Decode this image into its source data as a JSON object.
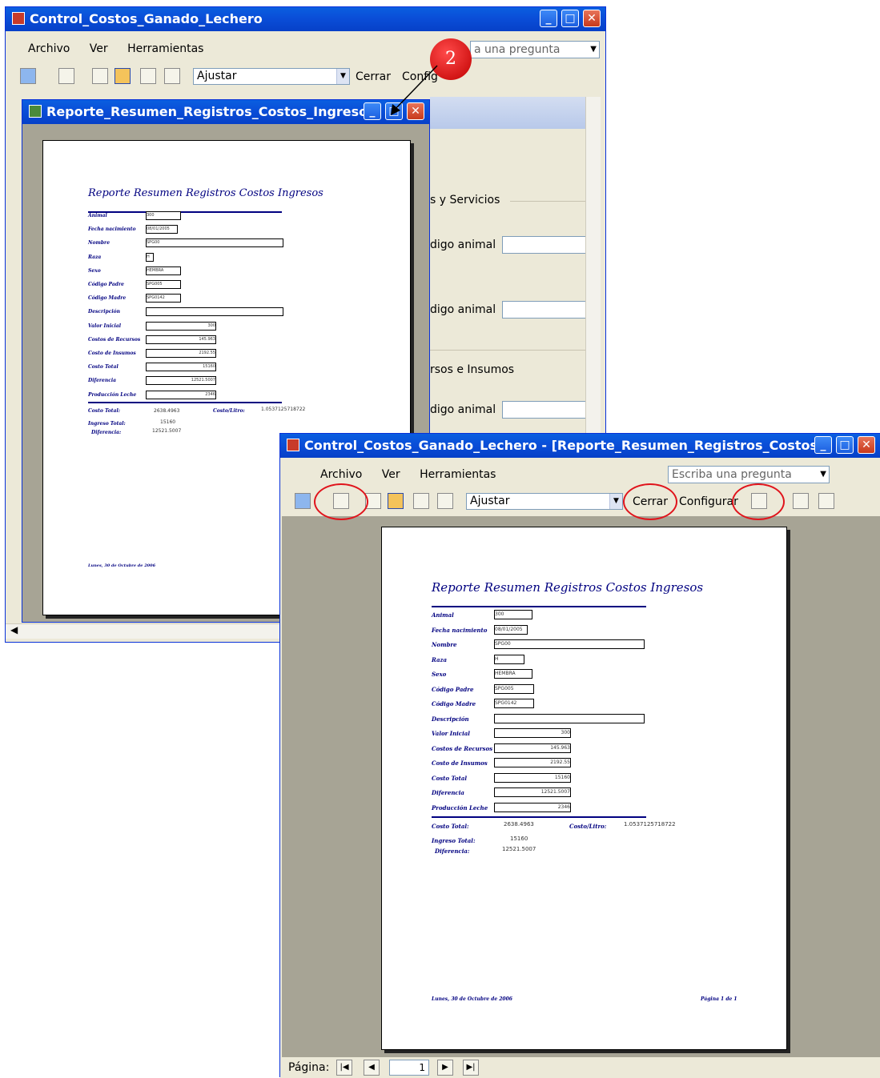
{
  "back_window": {
    "title": "Control_Costos_Ganado_Lechero",
    "menu": [
      "Archivo",
      "Ver",
      "Herramientas"
    ],
    "ask_placeholder": "a una pregunta",
    "zoom": "Ajustar",
    "cerrar": "Cerrar",
    "config": "Config",
    "form_labels": [
      "s y Servicios",
      "digo animal",
      "digo animal",
      "rsos e Insumos",
      "digo animal"
    ]
  },
  "inner_window": {
    "title": "Reporte_Resumen_Registros_Costos_Ingresos"
  },
  "callout_number": "2",
  "front_window": {
    "title": "Control_Costos_Ganado_Lechero - [Reporte_Resumen_Registros_Costos...",
    "menu": [
      "Archivo",
      "Ver",
      "Herramientas"
    ],
    "ask_placeholder": "Escriba una pregunta",
    "zoom": "Ajustar",
    "cerrar": "Cerrar",
    "config": "Configurar",
    "pagina_label": "Página:",
    "pagina_value": "1"
  },
  "report": {
    "title": "Reporte Resumen Registros Costos Ingresos",
    "fields": [
      {
        "label": "Animal",
        "value": "300"
      },
      {
        "label": "Fecha nacimiento",
        "value": "08/01/2005"
      },
      {
        "label": "Nombre",
        "value": "SPG00"
      },
      {
        "label": "Raza",
        "value": "H"
      },
      {
        "label": "Sexo",
        "value": "HEMBRA"
      },
      {
        "label": "Código Padre",
        "value": "SPG005"
      },
      {
        "label": "Código Madre",
        "value": "SPG0142"
      },
      {
        "label": "Descripción",
        "value": ""
      },
      {
        "label": "Valor Inicial",
        "value": "300"
      },
      {
        "label": "Costos de Recursos",
        "value": "145.963"
      },
      {
        "label": "Costo de Insumos",
        "value": "2192.55"
      },
      {
        "label": "Costo Total",
        "value": "15160"
      },
      {
        "label": "Diferencia",
        "value": "12521.5007"
      },
      {
        "label": "Producción Leche",
        "value": "2346"
      }
    ],
    "summary": {
      "costo_total_label": "Costo Total:",
      "costo_total_value": "2638.4963",
      "costo_litro_label": "Costo/Litro:",
      "costo_litro_value": "1.0537125718722",
      "ingreso_total_label": "Ingreso Total:",
      "ingreso_total_value": "15160",
      "diferencia_label": "Diferencia:",
      "diferencia_value": "12521.5007"
    },
    "footer_date": "Lunes, 30 de Octubre de 2006",
    "footer_page": "Página 1 de 1"
  }
}
